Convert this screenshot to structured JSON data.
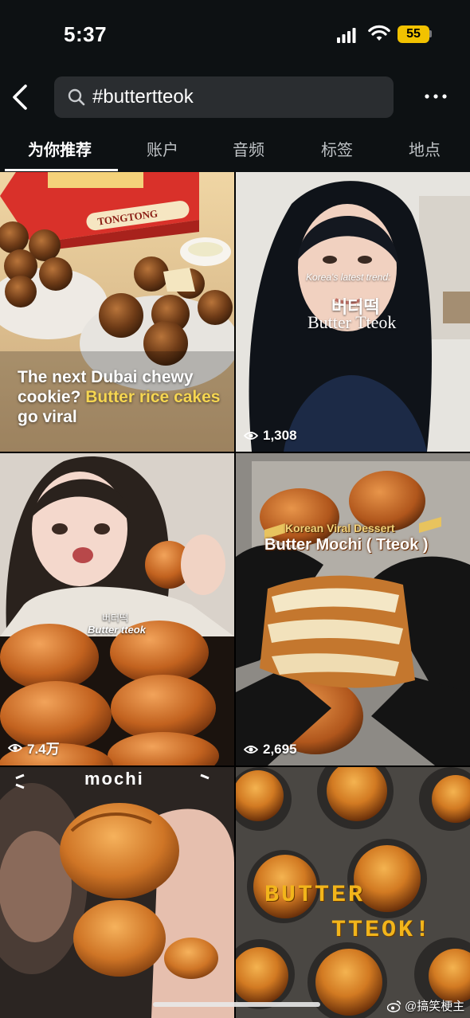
{
  "status_bar": {
    "time": "5:37",
    "battery": "55"
  },
  "header": {
    "search_query": "#buttertteok",
    "back_icon": "chevron-left-icon",
    "more_icon": "ellipsis-icon"
  },
  "tabs": [
    {
      "label": "为你推荐",
      "active": true
    },
    {
      "label": "账户",
      "active": false
    },
    {
      "label": "音频",
      "active": false
    },
    {
      "label": "标签",
      "active": false
    },
    {
      "label": "地点",
      "active": false
    }
  ],
  "tiles": [
    {
      "caption_part1": "The next Dubai chewy cookie? ",
      "caption_highlight": "Butter rice cakes",
      "caption_part2": " go viral",
      "box_text": "TONGTONG"
    },
    {
      "overlay_sub": "Korea's latest trend:",
      "overlay_korean": "버터떡",
      "overlay_english": "Butter Tteok",
      "views": "1,308"
    },
    {
      "overlay_korean": "버터떡",
      "overlay_english": "Butter tteok",
      "views": "7.4万"
    },
    {
      "overlay_line1": "Korean Viral Dessert",
      "overlay_line2": "Butter Mochi ( Tteok )",
      "views": "2,695"
    },
    {
      "overlay_text": "mochi"
    },
    {
      "overlay_line1": "BUTTER",
      "overlay_line2": "TTEOK!"
    }
  ],
  "watermark": "@搞笑梗主",
  "colors": {
    "background": "#0d1113",
    "search_bg": "#2a2d30",
    "highlight": "#f6d651",
    "battery": "#f2c200"
  }
}
